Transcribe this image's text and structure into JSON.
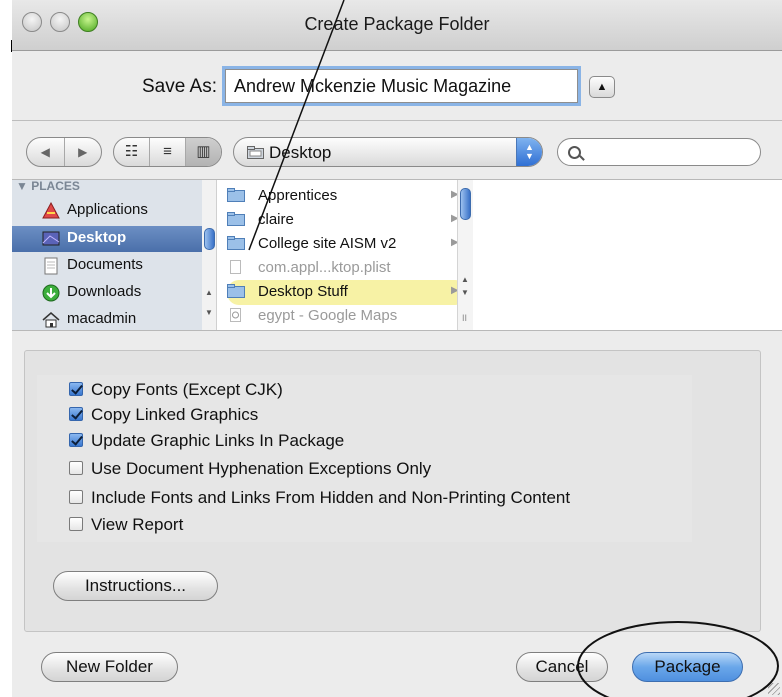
{
  "window": {
    "title": "Create Package Folder"
  },
  "save": {
    "label": "Save As:",
    "value": "Andrew Mckenzie Music Magazine"
  },
  "toolbar": {
    "back_glyph": "◀",
    "forward_glyph": "▶",
    "view_icon_glyph": "☷",
    "view_list_glyph": "≡",
    "view_column_glyph": "▥",
    "location": "Desktop",
    "search_placeholder": ""
  },
  "sidebar": {
    "section": "▼ PLACES",
    "items": [
      {
        "label": "Applications",
        "icon": "applications-icon"
      },
      {
        "label": "Desktop",
        "icon": "desktop-icon",
        "selected": true
      },
      {
        "label": "Documents",
        "icon": "documents-icon"
      },
      {
        "label": "Downloads",
        "icon": "downloads-icon"
      },
      {
        "label": "macadmin",
        "icon": "home-icon"
      }
    ]
  },
  "files": [
    {
      "name": "Apprentices",
      "type": "folder"
    },
    {
      "name": "claire",
      "type": "folder"
    },
    {
      "name": "College site AISM v2",
      "type": "folder"
    },
    {
      "name": "com.appl...ktop.plist",
      "type": "file"
    },
    {
      "name": "Desktop Stuff",
      "type": "folder",
      "highlighted": true
    },
    {
      "name": "egypt - Google Maps",
      "type": "file"
    }
  ],
  "options": {
    "checkboxes": [
      {
        "label": "Copy Fonts (Except CJK)",
        "checked": true
      },
      {
        "label": "Copy Linked Graphics",
        "checked": true
      },
      {
        "label": "Update Graphic Links In Package",
        "checked": true
      },
      {
        "label": "Use Document Hyphenation Exceptions Only",
        "checked": false
      },
      {
        "label": "Include Fonts and Links From Hidden and Non-Printing Content",
        "checked": false
      },
      {
        "label": "View Report",
        "checked": false
      }
    ],
    "instructions_label": "Instructions..."
  },
  "footer": {
    "new_folder": "New Folder",
    "cancel": "Cancel",
    "package": "Package"
  },
  "colors": {
    "accent": "#4f90df",
    "selection": "#4a6faa",
    "highlight": "#f7f2a5"
  }
}
